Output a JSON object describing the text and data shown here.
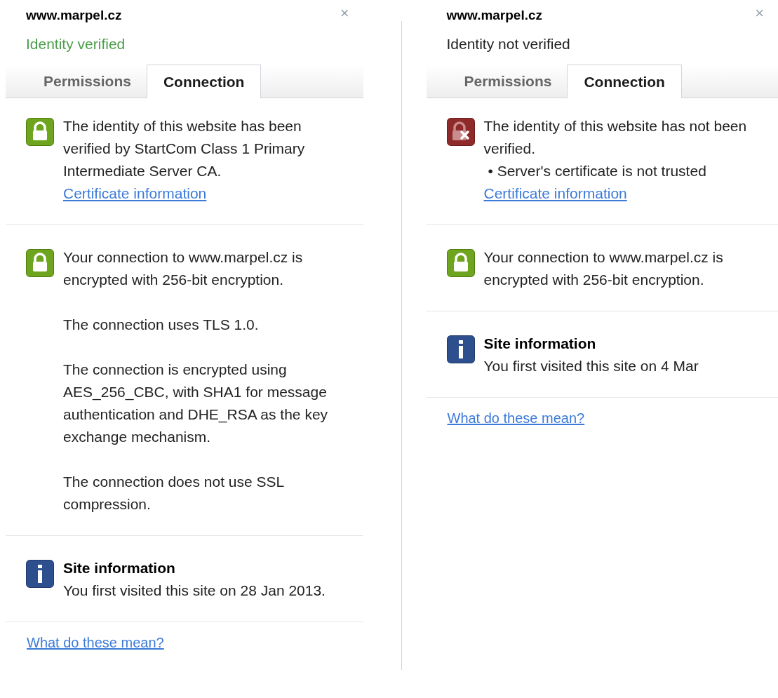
{
  "panels": [
    {
      "title": "www.marpel.cz",
      "close": "×",
      "identity": {
        "text": "Identity verified",
        "verified": true
      },
      "tabs": [
        {
          "label": "Permissions",
          "selected": false
        },
        {
          "label": "Connection",
          "selected": true
        }
      ],
      "sections": [
        {
          "kind": "lock_ok",
          "paragraphs": [
            "The identity of this website has been verified by StartCom Class 1 Primary Intermediate Server CA."
          ],
          "link": "Certificate information"
        },
        {
          "kind": "lock_ok",
          "paragraphs": [
            "Your connection to www.marpel.cz is encrypted with 256-bit encryption.",
            "The connection uses TLS 1.0.",
            "The connection is encrypted using AES_256_CBC, with SHA1 for message authentication and DHE_RSA as the key exchange mechanism.",
            "The connection does not use SSL compression."
          ]
        },
        {
          "kind": "info",
          "heading": "Site information",
          "paragraphs": [
            "You first visited this site on 28 Jan 2013."
          ]
        }
      ],
      "footer_link": "What do these mean?"
    },
    {
      "title": "www.marpel.cz",
      "close": "×",
      "identity": {
        "text": "Identity not verified",
        "verified": false
      },
      "tabs": [
        {
          "label": "Permissions",
          "selected": false
        },
        {
          "label": "Connection",
          "selected": true
        }
      ],
      "sections": [
        {
          "kind": "lock_error",
          "paragraphs": [
            "The identity of this website has not been verified.",
            "• Server's certificate is not trusted"
          ],
          "link": "Certificate information"
        },
        {
          "kind": "lock_ok",
          "paragraphs": [
            "Your connection to www.marpel.cz is encrypted with 256-bit encryption."
          ]
        },
        {
          "kind": "info",
          "heading": "Site information",
          "paragraphs": [
            "You first visited this site on 4 Mar"
          ]
        }
      ],
      "footer_link": "What do these mean?"
    }
  ]
}
